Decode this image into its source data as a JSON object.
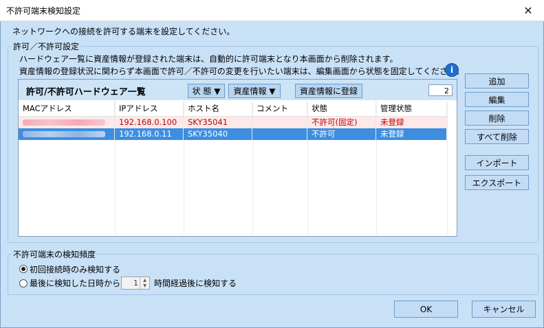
{
  "window": {
    "title": "不許可端末検知設定",
    "close_glyph": "✕"
  },
  "description": "ネットワークへの接続を許可する端末を設定してください。",
  "permit_group": {
    "label": "許可／不許可設定",
    "info_line1": "ハードウェア一覧に資産情報が登録された端末は、自動的に許可端末となり本画面から削除されます。",
    "info_line2": "資産情報の登録状況に関わらず本画面で許可／不許可の変更を行いたい端末は、編集画面から状態を固定してください。",
    "info_icon": "i"
  },
  "list": {
    "title": "許可/不許可ハードウェア一覧",
    "status_button": "状 態 ▼",
    "asset_button": "資産情報 ▼",
    "register_button": "資産情報に登録",
    "count": "2",
    "columns": [
      "MACアドレス",
      "IPアドレス",
      "ホスト名",
      "コメント",
      "状態",
      "管理状態"
    ],
    "rows": [
      {
        "mac": "",
        "ip": "192.168.0.100",
        "host": "SKY35041",
        "comment": "",
        "status": "不許可(固定)",
        "mgmt": "未登録"
      },
      {
        "mac": "",
        "ip": "192.168.0.11",
        "host": "SKY35040",
        "comment": "",
        "status": "不許可",
        "mgmt": "未登録"
      }
    ]
  },
  "side_buttons": {
    "add": "追加",
    "edit": "編集",
    "delete": "削除",
    "delete_all": "すべて削除",
    "import": "インポート",
    "export": "エクスポート"
  },
  "detect_group": {
    "label": "不許可端末の検知頻度",
    "option1": "初回接続時のみ検知する",
    "option2_prefix": "最後に検知した日時から",
    "hours_value": "1",
    "option2_suffix": "時間経過後に検知する"
  },
  "footer": {
    "ok": "OK",
    "cancel": "キャンセル"
  }
}
